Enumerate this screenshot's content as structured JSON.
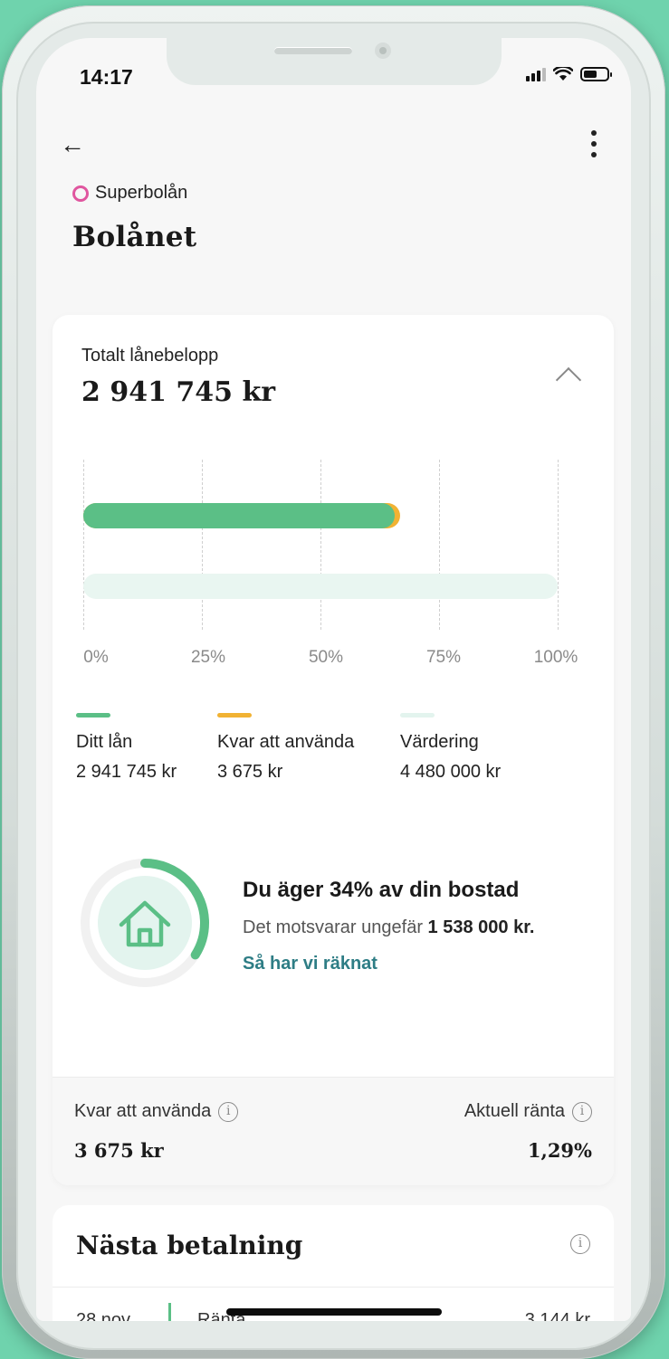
{
  "status_bar": {
    "time": "14:17"
  },
  "header": {
    "product_name": "Superbolån",
    "title": "Bolånet"
  },
  "summary": {
    "total_label": "Totalt lånebelopp",
    "total_value": "2 941 745 kr"
  },
  "chart_data": {
    "type": "bar",
    "orientation": "horizontal",
    "x_ticks": [
      "0%",
      "25%",
      "50%",
      "75%",
      "100%"
    ],
    "xlim": [
      0,
      100
    ],
    "series": [
      {
        "name": "Ditt lån",
        "value_percent": 65.66,
        "color": "#5bbf86"
      },
      {
        "name": "Kvar att använda",
        "value_percent": 0.08,
        "color": "#f1b233"
      },
      {
        "name": "Värdering",
        "value_percent": 100,
        "color": "#e9f6f1"
      }
    ]
  },
  "legend": [
    {
      "label": "Ditt lån",
      "value": "2 941 745 kr",
      "color": "#5bbf86"
    },
    {
      "label": "Kvar att använda",
      "value": "3 675 kr",
      "color": "#f1b233"
    },
    {
      "label": "Värdering",
      "value": "4 480 000 kr",
      "color": "#e9f6f1"
    }
  ],
  "ownership": {
    "percent": 34,
    "title": "Du äger 34% av din bostad",
    "subtitle_prefix": "Det motsvarar ungefär",
    "subtitle_amount": "1 538 000 kr.",
    "link": "Så har vi räknat",
    "icon": "house-icon"
  },
  "footer": {
    "remaining_label": "Kvar att använda",
    "remaining_value": "3 675 kr",
    "rate_label": "Aktuell ränta",
    "rate_value": "1,29%"
  },
  "next_payment": {
    "title": "Nästa betalning",
    "date": "28 nov",
    "label": "Ränta",
    "amount": "3 144 kr"
  },
  "colors": {
    "accent": "#5bbf86",
    "link": "#2e7d85",
    "product": "#e0569f",
    "background": "#6fd3ad"
  }
}
